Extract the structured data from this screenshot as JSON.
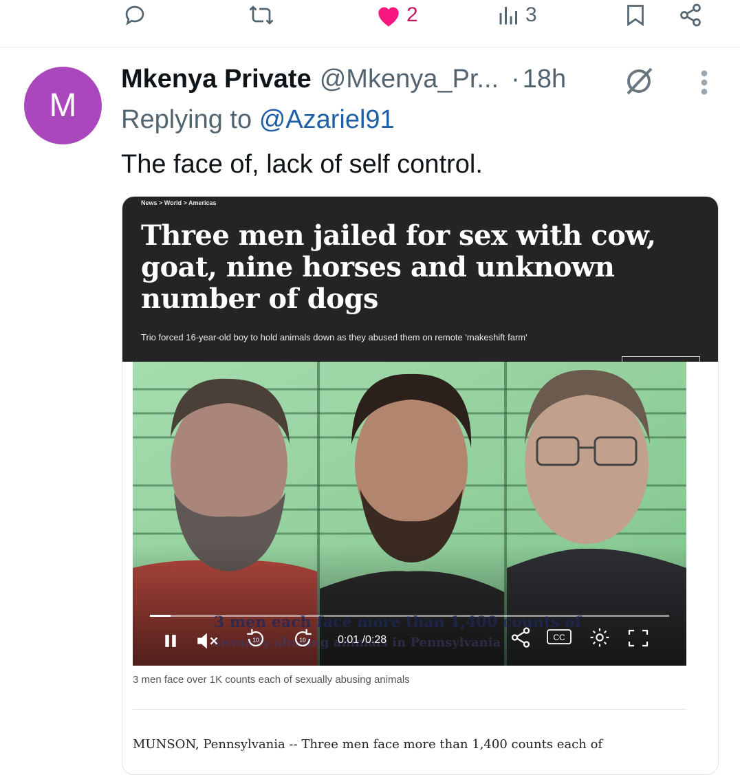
{
  "actions": {
    "likes": "2",
    "views": "3"
  },
  "tweet": {
    "avatar_letter": "M",
    "display_name": "Mkenya Private",
    "handle": "@Mkenya_Pr...",
    "dot": "·",
    "time": "18h",
    "reply_prefix": "Replying to",
    "reply_handle": "@Azariel91",
    "text": "The face of, lack of self control."
  },
  "card": {
    "breadcrumb": "News > World > Americas",
    "headline": "Three men jailed for sex with cow, goat, nine horses and unknown number of dogs",
    "subheadline": "Trio forced 16-year-old boy to hold animals down as they abused them on remote 'makeshift farm'",
    "video": {
      "overlay_text_1": "3 men each face more than 1,400 counts of",
      "overlay_text_2": "sexually abusing animals in Pennsylvania",
      "current_time": "0:01",
      "duration": "0:28",
      "progress": 0.04,
      "cc_label": "CC",
      "replay_seconds": "10",
      "forward_seconds": "10"
    },
    "caption": "3 men face over 1K counts each of sexually abusing animals",
    "body_start": "MUNSON, Pennsylvania -- Three men face more than 1,400 counts each of"
  },
  "colors": {
    "like": "#f91880",
    "avatar": "#ab47bc",
    "link": "#1d5fa7",
    "secondary": "#536471"
  }
}
